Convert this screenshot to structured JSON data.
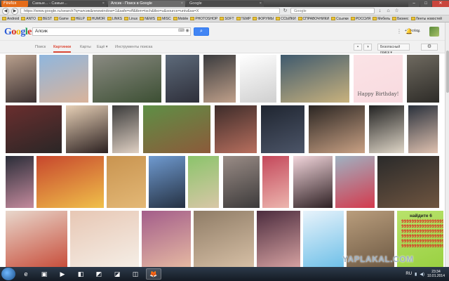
{
  "browser": {
    "menu_label": "Firefox",
    "tabs": [
      {
        "title": "Самые... - Самые...",
        "active": false
      },
      {
        "title": "Алсик - Поиск в Google",
        "active": true
      },
      {
        "title": "Google",
        "active": false
      }
    ],
    "url": "https://www.google.ru/search?q=алсик&newwindow=1&safe=off&tbm=isch&tbo=u&source=univ&sa=X",
    "search_engine_text": "Google",
    "bookmarks": [
      "Android",
      "ANTO",
      "BEST",
      "Game",
      "HELP",
      "HUMOR",
      "LINKS",
      "Linux",
      "NEWS",
      "MISC",
      "Mobile",
      "PHOTOSHOP",
      "SOFT",
      "TEMP",
      "ФОРУМЫ",
      "ССЫЛКИ",
      "СПРАВОЧНИКИ",
      "Ссылки",
      "РОССИЯ",
      "Мебель",
      "Бизнес",
      "Ленты новостей"
    ]
  },
  "google": {
    "logo": [
      "G",
      "o",
      "o",
      "g",
      "l",
      "e"
    ],
    "query": "Алсик",
    "search_button_icon": "magnifier-icon",
    "account_name": "+Nikolay",
    "tabs": [
      "Поиск",
      "Картинки",
      "Карты",
      "Ещё ▾",
      "Инструменты поиска"
    ],
    "active_tab": "Картинки",
    "safe_search_label": "Безопасный поиск ▾",
    "images": [
      {
        "caption": "",
        "colors": [
          "#b9a08d",
          "#3b3031"
        ]
      },
      {
        "caption": "",
        "colors": [
          "#8fb6de",
          "#d9b39a"
        ]
      },
      {
        "caption": "",
        "colors": [
          "#8a8a82",
          "#3c4f33"
        ]
      },
      {
        "caption": "",
        "colors": [
          "#5d6a7a",
          "#2e2f3a"
        ]
      },
      {
        "caption": "",
        "colors": [
          "#3a3b3e",
          "#c0a08a"
        ]
      },
      {
        "caption": "",
        "colors": [
          "#ffffff",
          "#cfcfcf"
        ]
      },
      {
        "caption": "",
        "colors": [
          "#3f5a6e",
          "#c9b27d"
        ]
      },
      {
        "caption": "",
        "colors": [
          "#fbe3e6",
          "#f8dadf"
        ]
      },
      {
        "caption": "",
        "colors": [
          "#6f6a60",
          "#2d2b27"
        ]
      },
      {
        "caption": "",
        "colors": [
          "#6a2e2e",
          "#2a2626"
        ]
      },
      {
        "caption": "",
        "colors": [
          "#e7d0b6",
          "#2b2020"
        ]
      },
      {
        "caption": "",
        "colors": [
          "#3a3a3a",
          "#e0d1c4"
        ]
      },
      {
        "caption": "",
        "colors": [
          "#5e8f46",
          "#8c5a3a"
        ]
      },
      {
        "caption": "",
        "colors": [
          "#3d2c2a",
          "#b86f5e"
        ]
      },
      {
        "caption": "",
        "colors": [
          "#1f2530",
          "#4c5568"
        ]
      },
      {
        "caption": "",
        "colors": [
          "#2a2522",
          "#c9a184"
        ]
      },
      {
        "caption": "",
        "colors": [
          "#222222",
          "#dfd6c7"
        ]
      },
      {
        "caption": "",
        "colors": [
          "#29303b",
          "#e0c2b0"
        ]
      },
      {
        "caption": "",
        "colors": [
          "#2a2d38",
          "#c48a9d"
        ]
      },
      {
        "caption": "",
        "colors": [
          "#c7462d",
          "#f0c04a"
        ]
      },
      {
        "caption": "",
        "colors": [
          "#c99450",
          "#e3b876"
        ]
      },
      {
        "caption": "",
        "colors": [
          "#6f9ad0",
          "#253142"
        ]
      },
      {
        "caption": "",
        "colors": [
          "#8bc46b",
          "#d8c7a7"
        ]
      },
      {
        "caption": "",
        "colors": [
          "#9a8c86",
          "#3c3a3a"
        ]
      },
      {
        "caption": "",
        "colors": [
          "#c4485b",
          "#ecb5ae"
        ]
      },
      {
        "caption": "",
        "colors": [
          "#f3d6dc",
          "#2e2023"
        ]
      },
      {
        "caption": "",
        "colors": [
          "#9fb2c2",
          "#d43a4d"
        ]
      },
      {
        "caption": "",
        "colors": [
          "#2a2a2a",
          "#6f5540"
        ]
      },
      {
        "caption": "",
        "colors": [
          "#e8d7cc",
          "#c84f3c"
        ]
      },
      {
        "caption": "",
        "colors": [
          "#e7c7b4",
          "#f5eee6"
        ]
      },
      {
        "caption": "",
        "colors": [
          "#a35d8a",
          "#e5b8a2"
        ]
      },
      {
        "caption": "",
        "colors": [
          "#8f7c66",
          "#d6bfa5"
        ]
      },
      {
        "caption": "",
        "colors": [
          "#4c2c3e",
          "#d4a0a0"
        ]
      },
      {
        "caption": "",
        "colors": [
          "#e8f3fb",
          "#6fc0e8"
        ]
      },
      {
        "caption": "",
        "colors": [
          "#b99d7c",
          "#6e5a44"
        ]
      },
      {
        "caption": "",
        "colors": [
          "#b8e26b",
          "#9ad142"
        ]
      },
      {
        "caption": "",
        "colors": [
          "#fff6b0",
          "#f2e27a"
        ]
      }
    ],
    "birthday_text": "Happy Birthday!",
    "card_header": "найдите 6",
    "card_lines": [
      "9999999999999999999",
      "9999999999999999999",
      "9999999999999999999",
      "9999999999999999999",
      "9999999999999999999",
      "9999999999999999999"
    ]
  },
  "watermark": "YAPLAKAL.COM",
  "taskbar": {
    "apps": [
      {
        "icon": "ie-icon",
        "glyph": "e"
      },
      {
        "icon": "explorer-icon",
        "glyph": "▣"
      },
      {
        "icon": "media-icon",
        "glyph": "▶"
      },
      {
        "icon": "app-icon",
        "glyph": "◧"
      },
      {
        "icon": "app2-icon",
        "glyph": "◩"
      },
      {
        "icon": "app3-icon",
        "glyph": "◪"
      },
      {
        "icon": "app4-icon",
        "glyph": "◫"
      },
      {
        "icon": "firefox-icon",
        "glyph": "🦊"
      }
    ],
    "lang": "RU",
    "time": "23:34",
    "date": "10.01.2014"
  }
}
